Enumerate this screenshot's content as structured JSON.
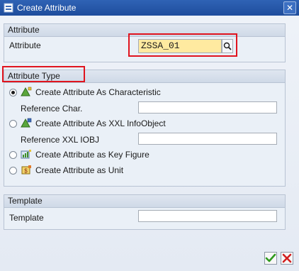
{
  "window": {
    "title": "Create Attribute"
  },
  "attribute_group": {
    "header": "Attribute",
    "label": "Attribute",
    "value": "ZSSA_01"
  },
  "attribute_type_group": {
    "header": "Attribute Type",
    "options": [
      {
        "label": "Create Attribute As Characteristic",
        "selected": true,
        "icon": "characteristic-icon"
      },
      {
        "label": "Create Attribute As XXL InfoObject",
        "selected": false,
        "icon": "xxl-infoobject-icon"
      },
      {
        "label": "Create Attribute as Key Figure",
        "selected": false,
        "icon": "key-figure-icon"
      },
      {
        "label": "Create Attribute as Unit",
        "selected": false,
        "icon": "unit-icon"
      }
    ],
    "reference_char_label": "Reference Char.",
    "reference_char_value": "",
    "reference_xxl_label": "Reference XXL IOBJ",
    "reference_xxl_value": ""
  },
  "template_group": {
    "header": "Template",
    "label": "Template",
    "value": ""
  },
  "footer": {
    "ok_icon": "check-icon",
    "cancel_icon": "cancel-icon"
  },
  "colors": {
    "highlight": "#e0141e",
    "title_bar": "#1e4d9c",
    "required_field": "#ffeaa0"
  }
}
